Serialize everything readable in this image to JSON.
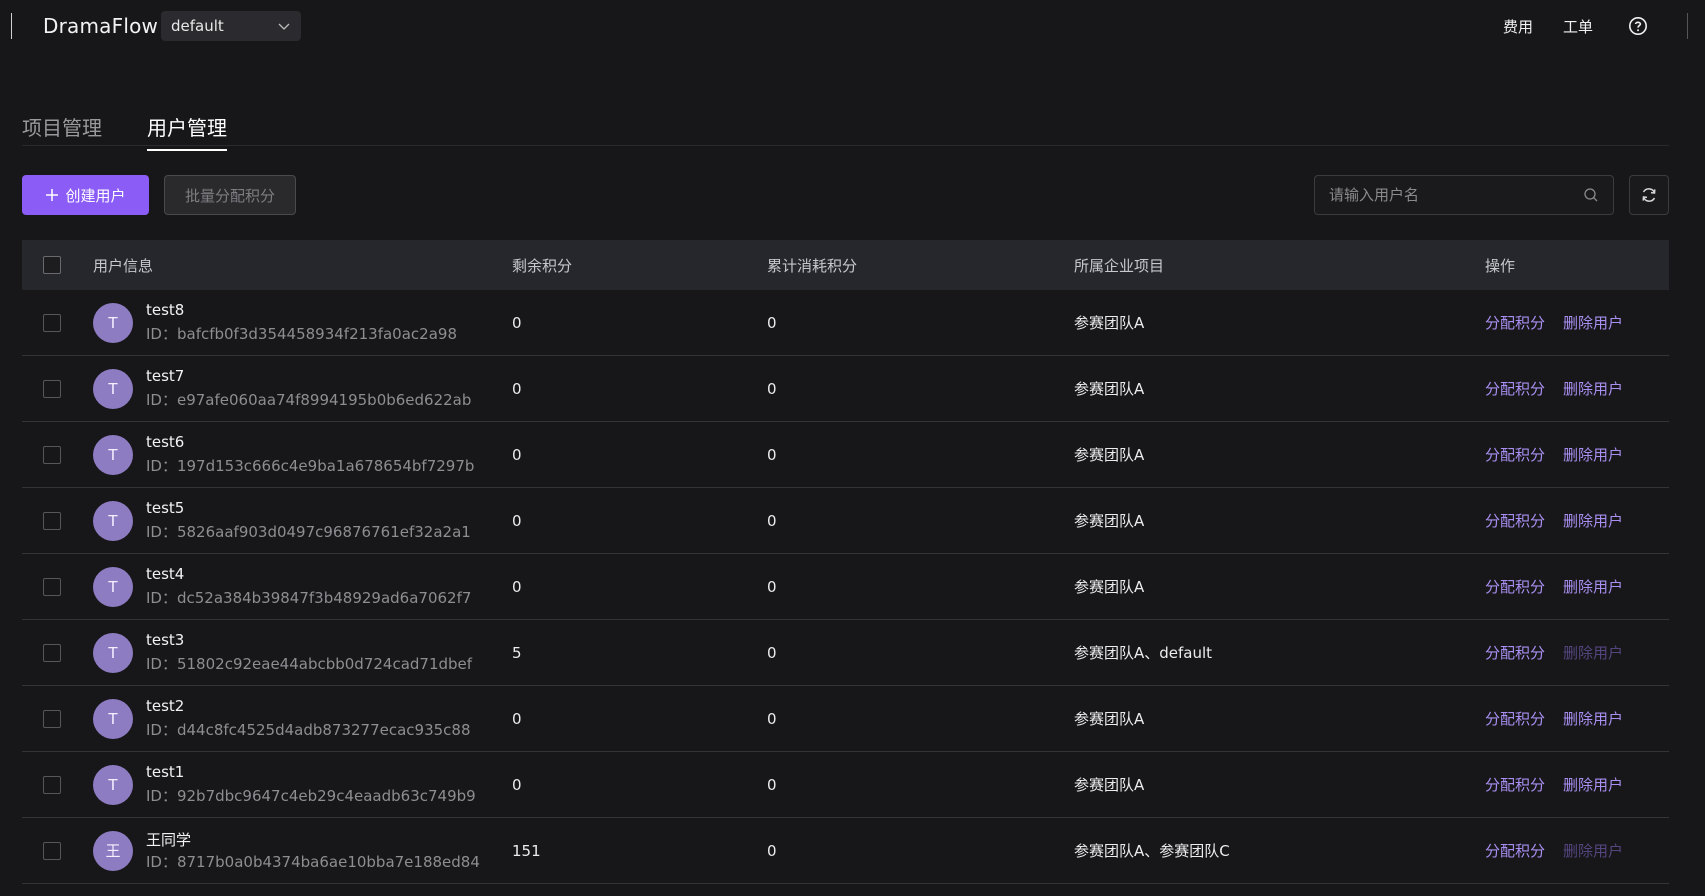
{
  "app": {
    "brand": "DramaFlow",
    "project_select": "default",
    "top_links": [
      "费用",
      "工单"
    ]
  },
  "tabs": [
    {
      "label": "项目管理",
      "active": false
    },
    {
      "label": "用户管理",
      "active": true
    }
  ],
  "toolbar": {
    "create_label": "创建用户",
    "batch_label": "批量分配积分",
    "search_placeholder": "请输入用户名"
  },
  "table": {
    "headers": [
      "用户信息",
      "剩余积分",
      "累计消耗积分",
      "所属企业项目",
      "操作"
    ],
    "rows": [
      {
        "avatar": "T",
        "name": "test8",
        "id": "ID：bafcfb0f3d354458934f213fa0ac2a98",
        "remaining": "0",
        "consumed": "0",
        "project": "参赛团队A",
        "action1": "分配积分",
        "action2": "删除用户",
        "delete_disabled": false
      },
      {
        "avatar": "T",
        "name": "test7",
        "id": "ID：e97afe060aa74f8994195b0b6ed622ab",
        "remaining": "0",
        "consumed": "0",
        "project": "参赛团队A",
        "action1": "分配积分",
        "action2": "删除用户",
        "delete_disabled": false
      },
      {
        "avatar": "T",
        "name": "test6",
        "id": "ID：197d153c666c4e9ba1a678654bf7297b",
        "remaining": "0",
        "consumed": "0",
        "project": "参赛团队A",
        "action1": "分配积分",
        "action2": "删除用户",
        "delete_disabled": false
      },
      {
        "avatar": "T",
        "name": "test5",
        "id": "ID：5826aaf903d0497c96876761ef32a2a1",
        "remaining": "0",
        "consumed": "0",
        "project": "参赛团队A",
        "action1": "分配积分",
        "action2": "删除用户",
        "delete_disabled": false
      },
      {
        "avatar": "T",
        "name": "test4",
        "id": "ID：dc52a384b39847f3b48929ad6a7062f7",
        "remaining": "0",
        "consumed": "0",
        "project": "参赛团队A",
        "action1": "分配积分",
        "action2": "删除用户",
        "delete_disabled": false
      },
      {
        "avatar": "T",
        "name": "test3",
        "id": "ID：51802c92eae44abcbb0d724cad71dbef",
        "remaining": "5",
        "consumed": "0",
        "project": "参赛团队A、default",
        "action1": "分配积分",
        "action2": "删除用户",
        "delete_disabled": true
      },
      {
        "avatar": "T",
        "name": "test2",
        "id": "ID：d44c8fc4525d4adb873277ecac935c88",
        "remaining": "0",
        "consumed": "0",
        "project": "参赛团队A",
        "action1": "分配积分",
        "action2": "删除用户",
        "delete_disabled": false
      },
      {
        "avatar": "T",
        "name": "test1",
        "id": "ID：92b7dbc9647c4eb29c4eaadb63c749b9",
        "remaining": "0",
        "consumed": "0",
        "project": "参赛团队A",
        "action1": "分配积分",
        "action2": "删除用户",
        "delete_disabled": false
      },
      {
        "avatar": "王",
        "name": "王同学",
        "id": "ID：8717b0a0b4374ba6ae10bba7e188ed84",
        "remaining": "151",
        "consumed": "0",
        "project": "参赛团队A、参赛团队C",
        "action1": "分配积分",
        "action2": "删除用户",
        "delete_disabled": true
      }
    ]
  },
  "colors": {
    "accent": "#8b5cf6",
    "link": "#a98ff2",
    "link_disabled": "#55457f",
    "avatar_bg": "#8e7cc3"
  },
  "icons": [
    "chevron-down-icon",
    "help-icon",
    "plus-icon",
    "search-icon",
    "refresh-icon"
  ]
}
